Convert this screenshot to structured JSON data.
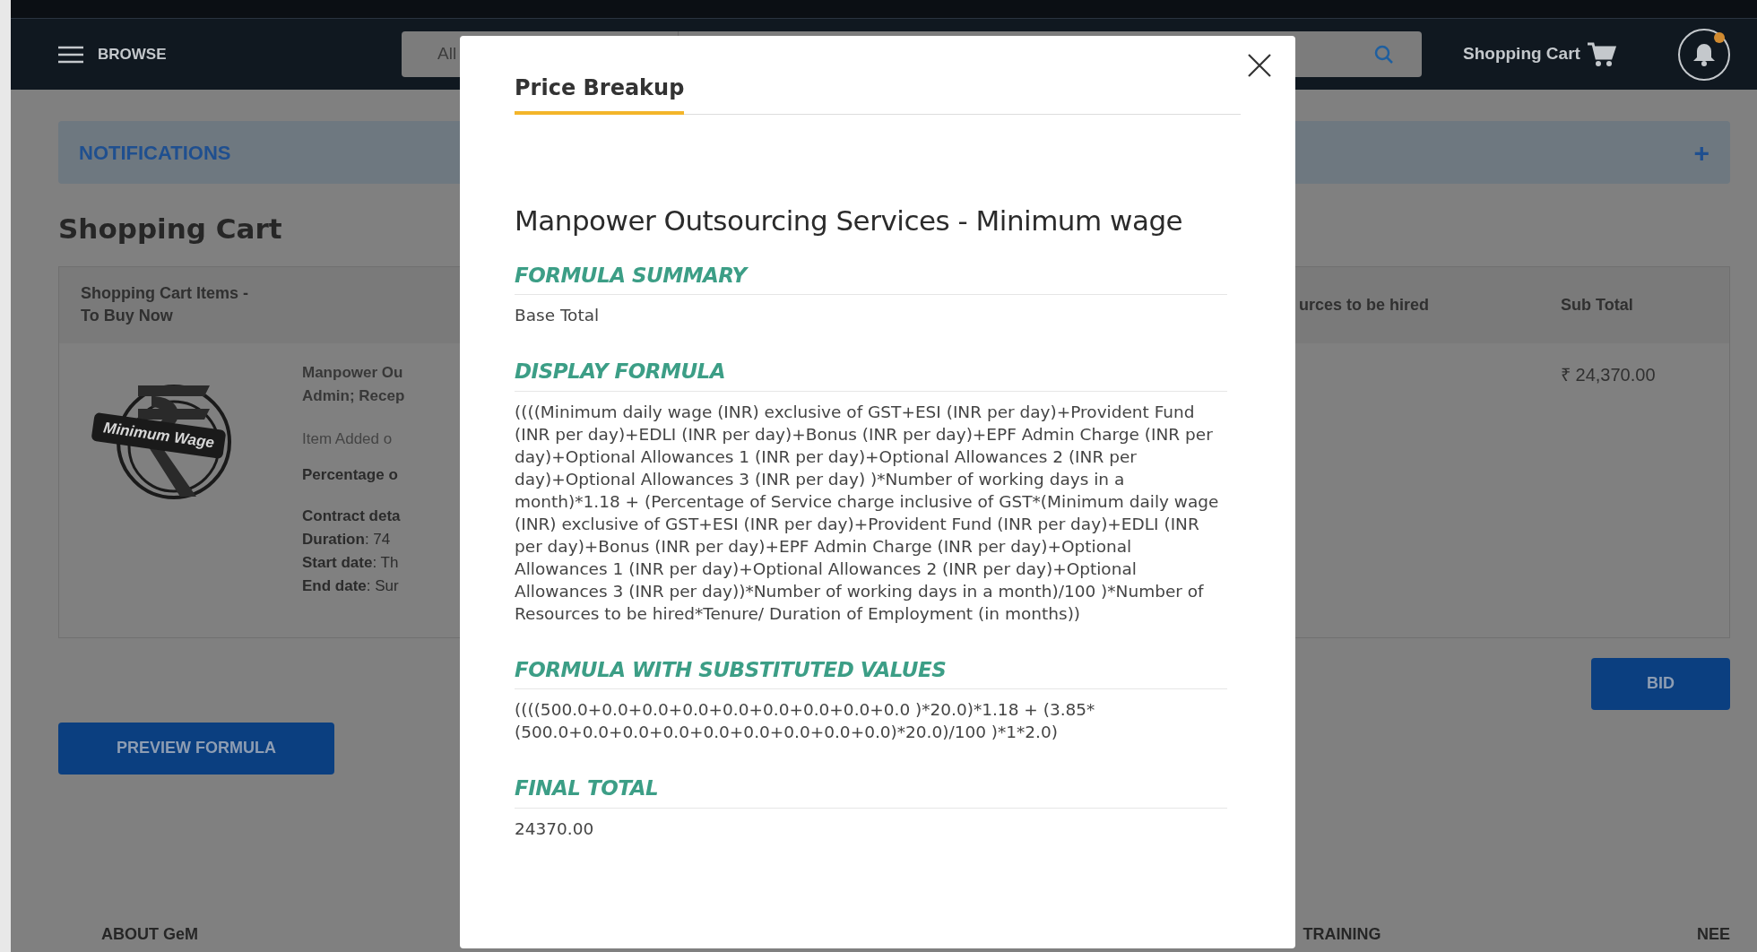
{
  "header": {
    "browse": "BROWSE",
    "search": {
      "category": "All"
    },
    "cart_link": "Shopping Cart",
    "notification_dot": true
  },
  "notifications": {
    "title": "NOTIFICATIONS",
    "expand": "+"
  },
  "page_title": "Shopping Cart",
  "cart_table": {
    "columns": [
      "Shopping Cart Items - To Buy Now",
      "urces to be hired",
      "Sub Total"
    ],
    "item": {
      "image_label": "Minimum Wage",
      "lines": [
        {
          "kind": "title",
          "text": "Manpower Ou"
        },
        {
          "kind": "title",
          "text": "Admin; Recep"
        },
        {
          "kind": "note",
          "text": "Item Added o"
        },
        {
          "kind": "bold",
          "text": "Percentage o"
        },
        {
          "kind": "bold",
          "text": "Contract deta"
        },
        {
          "kind": "pair",
          "label": "Duration",
          "value": ": 74"
        },
        {
          "kind": "pair",
          "label": "Start date",
          "value": ": Th"
        },
        {
          "kind": "pair",
          "label": "End date",
          "value": ": Sur"
        }
      ],
      "sub_total": "₹ 24,370.00"
    }
  },
  "bid_button": "BID",
  "preview_button": "PREVIEW FORMULA",
  "footer": [
    "ABOUT GeM",
    "TRAINING",
    "NEE"
  ],
  "modal": {
    "tabs": [
      {
        "label": "Price Breakup",
        "selected": true
      }
    ],
    "title": "Manpower Outsourcing Services - Minimum wage",
    "sections": [
      {
        "heading": "FORMULA SUMMARY",
        "body": "Base Total"
      },
      {
        "heading": "DISPLAY FORMULA",
        "body": "((((Minimum daily wage (INR) exclusive of GST+ESI (INR per day)+Provident Fund (INR per day)+EDLI (INR per day)+Bonus (INR per day)+EPF Admin Charge (INR per day)+Optional Allowances 1 (INR per day)+Optional Allowances 2 (INR per day)+Optional Allowances 3 (INR per day) )*Number of working days in a month)*1.18 + (Percentage of Service charge inclusive of GST*(Minimum daily wage (INR) exclusive of GST+ESI (INR per day)+Provident Fund (INR per day)+EDLI (INR per day)+Bonus (INR per day)+EPF Admin Charge (INR per day)+Optional Allowances 1 (INR per day)+Optional Allowances 2 (INR per day)+Optional Allowances 3 (INR per day))*Number of working days in a month)/100 )*Number of Resources to be hired*Tenure/ Duration of Employment (in months))"
      },
      {
        "heading": "FORMULA WITH SUBSTITUTED VALUES",
        "body": "((((500.0+0.0+0.0+0.0+0.0+0.0+0.0+0.0+0.0 )*20.0)*1.18 + (3.85* (500.0+0.0+0.0+0.0+0.0+0.0+0.0+0.0+0.0)*20.0)/100 )*1*2.0)"
      },
      {
        "heading": "FINAL TOTAL",
        "body": "24370.00"
      }
    ]
  }
}
